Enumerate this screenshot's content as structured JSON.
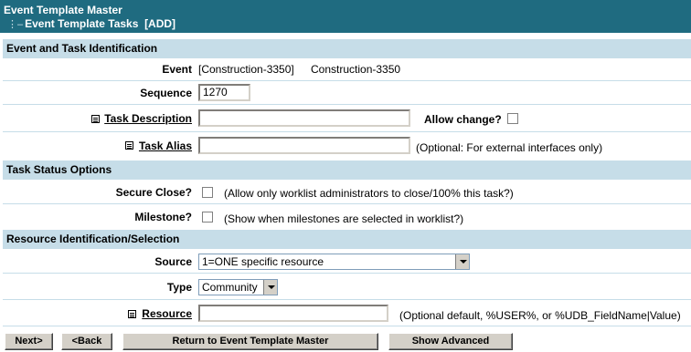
{
  "header": {
    "title": "Event Template Master",
    "subtitle": "Event Template Tasks  [ADD]"
  },
  "sections": {
    "identification": "Event and Task Identification",
    "status": "Task Status Options",
    "resource": "Resource Identification/Selection"
  },
  "event": {
    "label": "Event",
    "value_code": "[Construction-3350]",
    "value_name": "Construction-3350"
  },
  "sequence": {
    "label": "Sequence",
    "value": "1270"
  },
  "task_description": {
    "label": "Task Description",
    "value": "",
    "allow_change_label": "Allow change?",
    "allow_change_checked": false
  },
  "task_alias": {
    "label": "Task Alias",
    "value": "",
    "note": "(Optional: For external interfaces only)"
  },
  "secure_close": {
    "label": "Secure Close?",
    "checked": false,
    "note": "(Allow only worklist administrators to close/100% this task?)"
  },
  "milestone": {
    "label": "Milestone?",
    "checked": false,
    "note": "(Show when milestones are selected in worklist?)"
  },
  "source": {
    "label": "Source",
    "selected": "1=ONE specific resource"
  },
  "type": {
    "label": "Type",
    "selected": "Community"
  },
  "resource": {
    "label": "Resource",
    "value": "",
    "note": "(Optional default, %USER%, or %UDB_FieldName|Value)"
  },
  "buttons": {
    "next": "Next>",
    "back": "<Back",
    "return": "Return to Event Template Master",
    "advanced": "Show Advanced"
  }
}
